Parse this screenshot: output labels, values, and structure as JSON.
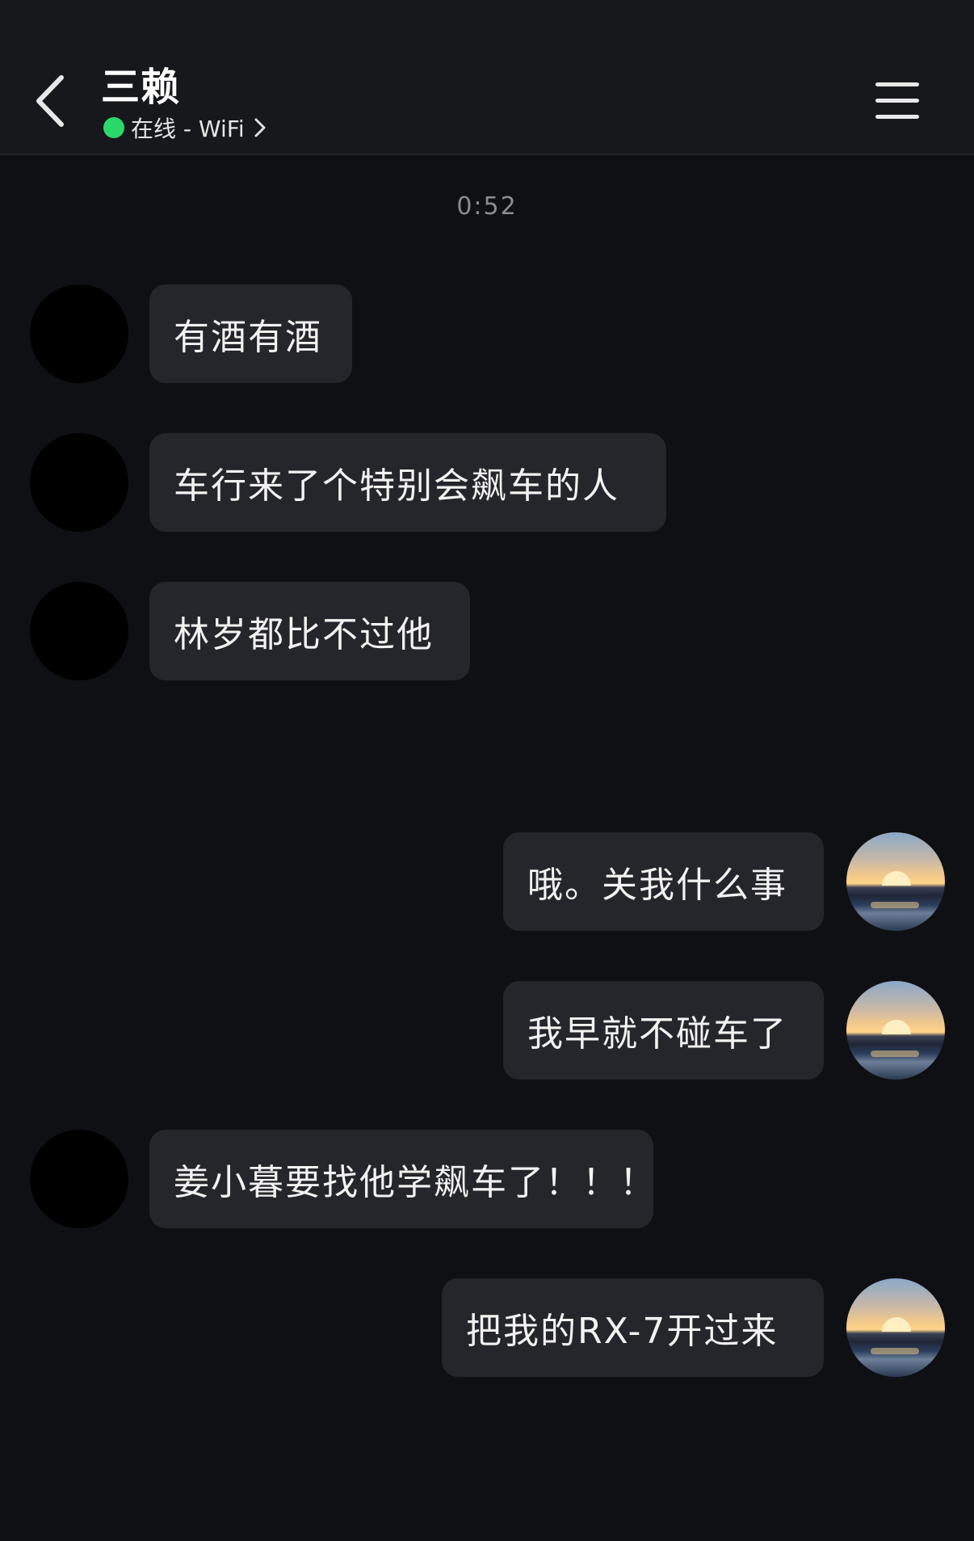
{
  "header": {
    "title": "三赖",
    "status_text": "在线 - WiFi",
    "status_color": "#2bd96b",
    "back_icon": "chevron-left-icon",
    "menu_icon": "hamburger-menu-icon"
  },
  "timestamp": "0:52",
  "messages": [
    {
      "side": "left",
      "text": "有酒有酒"
    },
    {
      "side": "left",
      "text": "车行来了个特别会飙车的人"
    },
    {
      "side": "left",
      "text": "林岁都比不过他"
    },
    {
      "side": "right",
      "text": "哦。关我什么事"
    },
    {
      "side": "right",
      "text": "我早就不碰车了"
    },
    {
      "side": "left",
      "text": "姜小暮要找他学飙车了！！！"
    },
    {
      "side": "right",
      "text": "把我的RX-7开过来"
    }
  ],
  "colors": {
    "background": "#0f1013",
    "header_background": "#17181b",
    "bubble_background": "#25262b",
    "text": "#f2f2f2"
  }
}
